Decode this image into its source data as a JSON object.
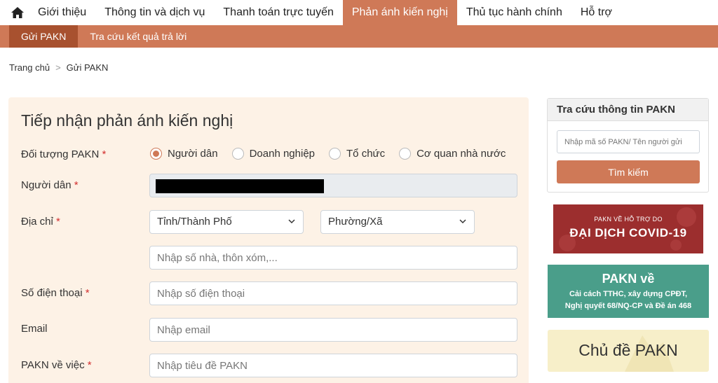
{
  "nav": {
    "home_icon": "home-icon",
    "items": [
      {
        "label": "Giới thiệu",
        "active": false
      },
      {
        "label": "Thông tin và dịch vụ",
        "active": false
      },
      {
        "label": "Thanh toán trực tuyến",
        "active": false
      },
      {
        "label": "Phản ánh kiến nghị",
        "active": true
      },
      {
        "label": "Thủ tục hành chính",
        "active": false
      },
      {
        "label": "Hỗ trợ",
        "active": false
      }
    ]
  },
  "subnav": {
    "items": [
      {
        "label": "Gửi PAKN",
        "active": true
      },
      {
        "label": "Tra cứu kết quả trả lời",
        "active": false
      }
    ]
  },
  "breadcrumb": {
    "home": "Trang chủ",
    "separator": ">",
    "current": "Gửi PAKN"
  },
  "form": {
    "title": "Tiếp nhận phản ánh kiến nghị",
    "required_mark": "*",
    "subject_label": "Đối tượng PAKN",
    "subject_options": [
      {
        "label": "Người dân",
        "checked": true
      },
      {
        "label": "Doanh nghiệp",
        "checked": false
      },
      {
        "label": "Tổ chức",
        "checked": false
      },
      {
        "label": "Cơ quan nhà nước",
        "checked": false
      }
    ],
    "citizen_label": "Người dân",
    "address_label": "Địa chỉ",
    "province_select": "Tỉnh/Thành Phố",
    "ward_select": "Phường/Xã",
    "address_placeholder": "Nhập số nhà, thôn xóm,...",
    "phone_label": "Số điện thoại",
    "phone_placeholder": "Nhập số điện thoại",
    "email_label": "Email",
    "email_placeholder": "Nhập email",
    "topic_label": "PAKN về việc",
    "topic_placeholder": "Nhập tiêu đề PAKN"
  },
  "sidebar": {
    "lookup_title": "Tra cứu thông tin PAKN",
    "lookup_placeholder": "Nhập mã số PAKN/ Tên người gửi",
    "lookup_button": "Tìm kiếm",
    "covid_small": "PAKN VỀ HỖ TRỢ DO",
    "covid_big": "ĐẠI DỊCH COVID-19",
    "reform_title": "PAKN về",
    "reform_line1": "Cải cách TTHC, xây dựng CPĐT,",
    "reform_line2": "Nghị quyết 68/NQ-CP và Đề án 468",
    "topic_banner": "Chủ đề PAKN"
  },
  "colors": {
    "accent": "#cf7957",
    "accent_dark": "#a8512f",
    "required": "#d32f2f",
    "form_bg": "#fdf2e6"
  }
}
